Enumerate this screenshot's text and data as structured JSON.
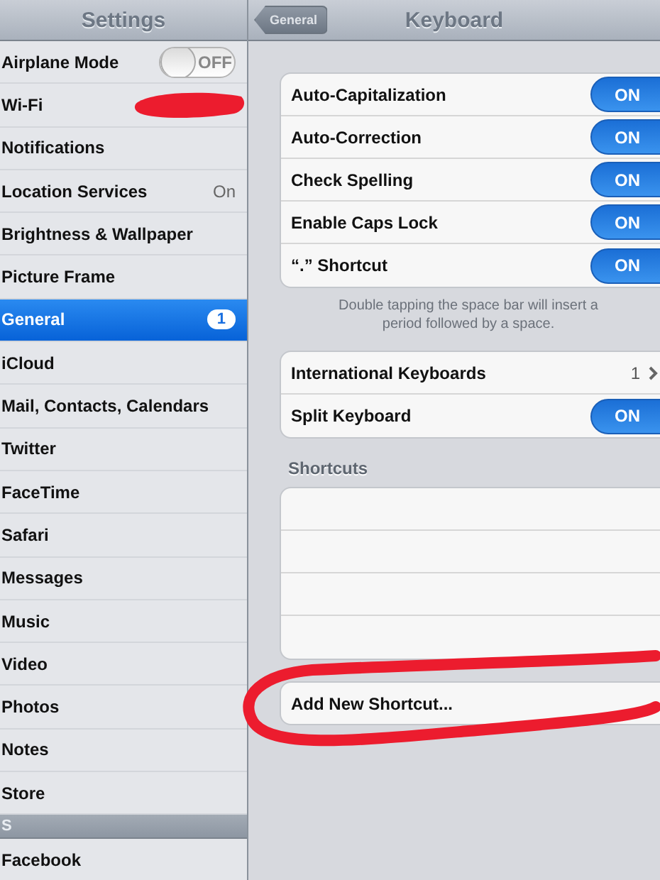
{
  "sidebar": {
    "title": "Settings",
    "items": [
      {
        "label": "Airplane Mode",
        "kind": "toggle",
        "on": false,
        "toggle_text": "OFF",
        "selected": false
      },
      {
        "label": "Wi-Fi",
        "kind": "plain",
        "selected": false
      },
      {
        "label": "Notifications",
        "kind": "plain",
        "selected": false
      },
      {
        "label": "Location Services",
        "kind": "value",
        "value": "On",
        "selected": false
      },
      {
        "label": "Brightness & Wallpaper",
        "kind": "plain",
        "selected": false
      },
      {
        "label": "Picture Frame",
        "kind": "plain",
        "selected": false
      },
      {
        "label": "General",
        "kind": "badge",
        "badge": "1",
        "selected": true
      },
      {
        "label": "iCloud",
        "kind": "plain",
        "selected": false
      },
      {
        "label": "Mail, Contacts, Calendars",
        "kind": "plain",
        "selected": false
      },
      {
        "label": "Twitter",
        "kind": "plain",
        "selected": false
      },
      {
        "label": "FaceTime",
        "kind": "plain",
        "selected": false
      },
      {
        "label": "Safari",
        "kind": "plain",
        "selected": false
      },
      {
        "label": "Messages",
        "kind": "plain",
        "selected": false
      },
      {
        "label": "Music",
        "kind": "plain",
        "selected": false
      },
      {
        "label": "Video",
        "kind": "plain",
        "selected": false
      },
      {
        "label": "Photos",
        "kind": "plain",
        "selected": false
      },
      {
        "label": "Notes",
        "kind": "plain",
        "selected": false
      },
      {
        "label": "Store",
        "kind": "plain",
        "selected": false
      }
    ],
    "section_header": "S",
    "more_items": [
      {
        "label": "Facebook",
        "selected": false
      }
    ]
  },
  "detail": {
    "back_button": "General",
    "title": "Keyboard",
    "groups": [
      {
        "rows": [
          {
            "label": "Auto-Capitalization",
            "kind": "toggle",
            "on": true,
            "toggle_text": "ON"
          },
          {
            "label": "Auto-Correction",
            "kind": "toggle",
            "on": true,
            "toggle_text": "ON"
          },
          {
            "label": "Check Spelling",
            "kind": "toggle",
            "on": true,
            "toggle_text": "ON"
          },
          {
            "label": "Enable Caps Lock",
            "kind": "toggle",
            "on": true,
            "toggle_text": "ON"
          },
          {
            "label": "“.” Shortcut",
            "kind": "toggle",
            "on": true,
            "toggle_text": "ON"
          }
        ],
        "footer": "Double tapping the space bar will insert a period followed by a space."
      },
      {
        "rows": [
          {
            "label": "International Keyboards",
            "kind": "value",
            "value": "1"
          },
          {
            "label": "Split Keyboard",
            "kind": "toggle",
            "on": true,
            "toggle_text": "ON"
          }
        ]
      }
    ],
    "shortcuts_header": "Shortcuts",
    "add_button": "Add New Shortcut..."
  }
}
